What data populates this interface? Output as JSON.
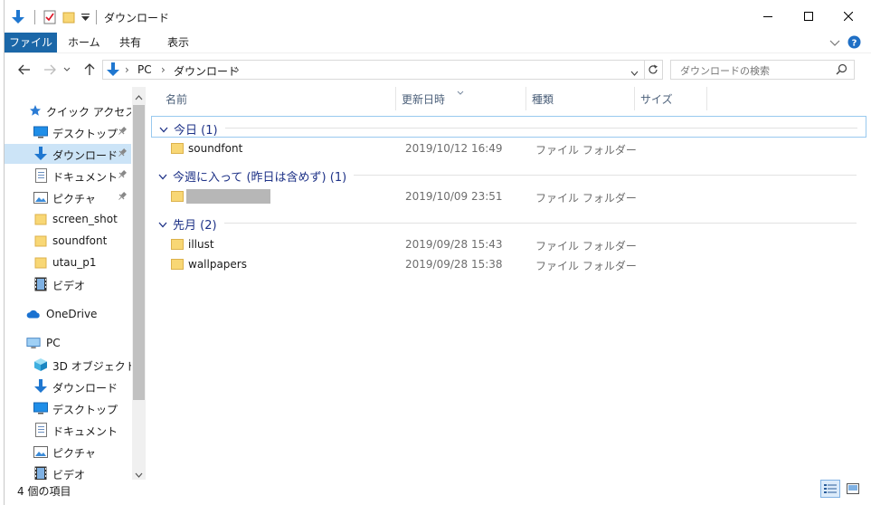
{
  "title": "ダウンロード",
  "ribbon": {
    "tabs": [
      "ファイル",
      "ホーム",
      "共有",
      "表示"
    ]
  },
  "address": {
    "crumbs": [
      "PC",
      "ダウンロード"
    ]
  },
  "search": {
    "placeholder": "ダウンロードの検索"
  },
  "sidebar": {
    "quick_access": "クイック アクセス",
    "pinned": [
      {
        "label": "デスクトップ",
        "icon": "desktop-icon"
      },
      {
        "label": "ダウンロード",
        "icon": "download-icon"
      },
      {
        "label": "ドキュメント",
        "icon": "document-icon"
      },
      {
        "label": "ピクチャ",
        "icon": "pictures-icon"
      }
    ],
    "recent": [
      {
        "label": "screen_shot",
        "icon": "folder-icon"
      },
      {
        "label": "soundfont",
        "icon": "folder-icon"
      },
      {
        "label": "utau_p1",
        "icon": "folder-icon"
      },
      {
        "label": "ビデオ",
        "icon": "video-icon"
      }
    ],
    "onedrive": "OneDrive",
    "pc": "PC",
    "pc_children": [
      {
        "label": "3D オブジェクト",
        "icon": "3d-objects-icon"
      },
      {
        "label": "ダウンロード",
        "icon": "download-icon"
      },
      {
        "label": "デスクトップ",
        "icon": "desktop-icon"
      },
      {
        "label": "ドキュメント",
        "icon": "document-icon"
      },
      {
        "label": "ピクチャ",
        "icon": "pictures-icon"
      },
      {
        "label": "ビデオ",
        "icon": "video-icon"
      }
    ]
  },
  "columns": {
    "name": "名前",
    "date": "更新日時",
    "type": "種類",
    "size": "サイズ"
  },
  "groups": [
    {
      "label": "今日 (1)",
      "items": [
        {
          "name": "soundfont",
          "date": "2019/10/12 16:49",
          "type": "ファイル フォルダー"
        }
      ]
    },
    {
      "label": "今週に入って (昨日は含めず) (1)",
      "items": [
        {
          "name": "",
          "date": "2019/10/09 23:51",
          "type": "ファイル フォルダー"
        }
      ]
    },
    {
      "label": "先月 (2)",
      "items": [
        {
          "name": "illust",
          "date": "2019/09/28 15:43",
          "type": "ファイル フォルダー"
        },
        {
          "name": "wallpapers",
          "date": "2019/09/28 15:38",
          "type": "ファイル フォルダー"
        }
      ]
    }
  ],
  "status": {
    "count": "4 個の項目"
  },
  "colors": {
    "accent": "#1b67a8",
    "selection": "#cce4f7",
    "folder": "#f8d775",
    "group_text": "#1e3287"
  }
}
